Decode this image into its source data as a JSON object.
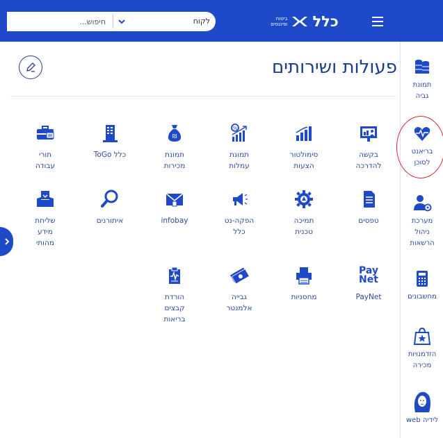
{
  "header": {
    "search_placeholder": "חיפוש...",
    "search_scope": "לקוח",
    "logo_main": "כלל",
    "logo_line1": "ביטוח",
    "logo_line2": "ופיננסים"
  },
  "main": {
    "title": "פעולות ושירותים",
    "tiles": [
      {
        "label": "בקשה להדרכה",
        "icon": "presentation-icon"
      },
      {
        "label": "סימולטור הצעות",
        "icon": "bar-chart-icon"
      },
      {
        "label": "תמונת עמלות",
        "icon": "growth-chart-icon"
      },
      {
        "label": "תמונת מכירות",
        "icon": "money-bag-icon"
      },
      {
        "label": "כלל ToGo",
        "icon": "building-icon"
      },
      {
        "label": "תורי עבודה",
        "icon": "briefcase-icon"
      },
      {
        "label": "טפסים",
        "icon": "document-icon"
      },
      {
        "label": "תמיכה טכנית",
        "icon": "gear-icon"
      },
      {
        "label": "הפקה-נט כלל",
        "icon": "megaphone-icon"
      },
      {
        "label": "infobay",
        "icon": "envelope-icon"
      },
      {
        "label": "איתורנים",
        "icon": "magnifier-icon"
      },
      {
        "label": "שליחת מידע מהותי",
        "icon": "mail-tray-icon"
      },
      {
        "label": "PayNet",
        "icon": "paynet-logo-icon",
        "logo_line1": "Pay",
        "logo_line2": "Net"
      },
      {
        "label": "מחסניות",
        "icon": "printer-icon"
      },
      {
        "label": "גבייה אלמנטר",
        "icon": "cash-stack-icon"
      },
      {
        "label": "הורדת קבצים בריאות",
        "icon": "health-clipboard-icon"
      }
    ]
  },
  "sidebar": {
    "items": [
      {
        "label": "תמונת גביה",
        "icon": "coins-icon"
      },
      {
        "label": "בריאנט לסוכן",
        "icon": "heart-pulse-icon"
      },
      {
        "label": "מערכת ניהול הרשאות",
        "icon": "user-gear-icon"
      },
      {
        "label": "מחשבונים",
        "icon": "calculator-icon"
      },
      {
        "label": "הזדמנויות מכירה",
        "icon": "shopping-bag-icon"
      },
      {
        "label": "לידיה web",
        "icon": "assistant-avatar-icon"
      }
    ]
  },
  "colors": {
    "header_bg": "#1e49c9",
    "text": "#1a3a8f",
    "icon": "#1e49c9",
    "highlight": "#d9232e"
  }
}
